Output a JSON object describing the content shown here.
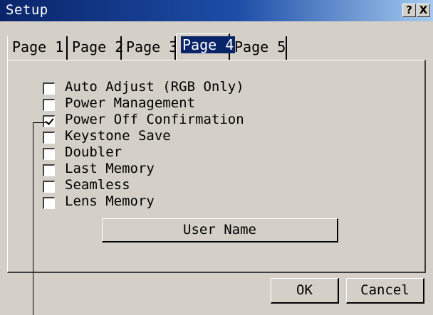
{
  "window": {
    "title": "Setup",
    "help_label": "?",
    "close_label": "X"
  },
  "tabs": [
    {
      "label": "Page 1",
      "active": false
    },
    {
      "label": "Page 2",
      "active": false
    },
    {
      "label": "Page 3",
      "active": false
    },
    {
      "label": "Page 4",
      "active": true
    },
    {
      "label": "Page 5",
      "active": false
    }
  ],
  "options": [
    {
      "label": "Auto Adjust (RGB Only)",
      "checked": false
    },
    {
      "label": "Power Management",
      "checked": false
    },
    {
      "label": "Power Off Confirmation",
      "checked": true
    },
    {
      "label": "Keystone Save",
      "checked": false
    },
    {
      "label": "Doubler",
      "checked": false
    },
    {
      "label": "Last Memory",
      "checked": false
    },
    {
      "label": "Seamless",
      "checked": false
    },
    {
      "label": "Lens Memory",
      "checked": false
    }
  ],
  "buttons": {
    "user_name": "User Name",
    "ok": "OK",
    "cancel": "Cancel"
  },
  "colors": {
    "title_bar": "#0a246a",
    "face": "#d4d0c8",
    "active_tab_highlight": "#0a246a"
  }
}
